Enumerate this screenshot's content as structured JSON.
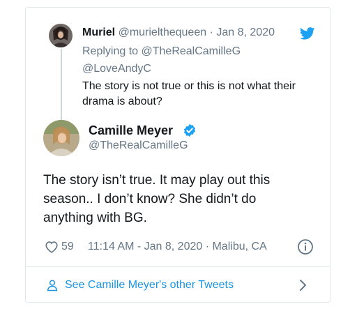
{
  "parent_tweet": {
    "name": "Muriel",
    "handle": "@murielthequeen",
    "separator": "·",
    "date": "Jan 8, 2020",
    "replying_prefix": "Replying to",
    "replying_to_1": "@TheRealCamilleG",
    "replying_to_2": "@LoveAndyC",
    "text": "The story is not true or this is not what their drama is about?"
  },
  "main_tweet": {
    "name": "Camille Meyer",
    "handle": "@TheRealCamilleG",
    "text": "The story isn’t true. It may play out this season.. I don’t know? She didn’t do anything with BG.",
    "likes": "59",
    "timestamp": "11:14 AM - Jan 8, 2020 · Malibu, CA"
  },
  "footer": {
    "label": "See Camille Meyer's other Tweets"
  },
  "icons": {
    "bird": "twitter-bird-icon",
    "verified": "verified-badge-icon",
    "heart": "heart-icon",
    "info": "info-icon",
    "person": "person-icon",
    "chevron": "chevron-right-icon"
  },
  "colors": {
    "brand": "#1da1f2",
    "link": "#1b95e0",
    "muted": "#657786",
    "text": "#14171a",
    "border": "#e1e8ed"
  }
}
